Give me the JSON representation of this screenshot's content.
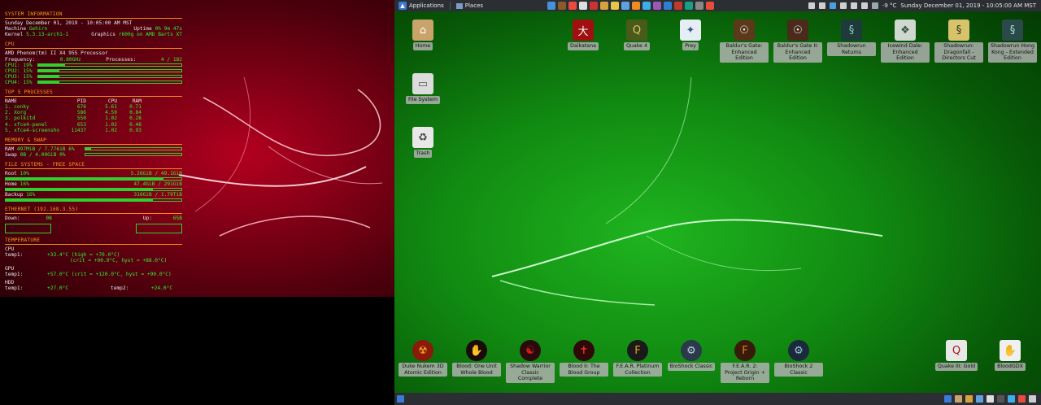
{
  "conky": {
    "system_header": "SYSTEM INFORMATION",
    "date": "Sunday December 01, 2019 - 10:05:00 AM MST",
    "machine_label": "Machine",
    "machine_value": "Gehirn",
    "uptime_label": "Uptime",
    "uptime_value": "0h 9m 47s",
    "kernel_label": "Kernel",
    "kernel_value": "5.3.13-arch1-1",
    "graphics_label": "Graphics",
    "graphics_value": "r600g on AMD Barts XT",
    "cpu_header": "CPU",
    "cpu_model": "AMD Phenom(tm) II X4 955 Processor",
    "frequency_label": "Frequency:",
    "frequency_value": "0.80GHz",
    "processes_label": "Processes:",
    "processes_value": "4 / 182",
    "cpus": [
      {
        "label": "CPU1:",
        "value": "19%",
        "percent": 19
      },
      {
        "label": "CPU2:",
        "value": "15%",
        "percent": 15
      },
      {
        "label": "CPU3:",
        "value": "15%",
        "percent": 15
      },
      {
        "label": "CPU4:",
        "value": "15%",
        "percent": 15
      }
    ],
    "top_header": "TOP 5 PROCESSES",
    "proc_columns": [
      "NAME",
      "PID",
      "CPU",
      "RAM"
    ],
    "processes": [
      {
        "name": "1. conky",
        "pid": "676",
        "cpu": "5.61",
        "ram": "0.71"
      },
      {
        "name": "2. Xorg",
        "pid": "586",
        "cpu": "4.59",
        "ram": "0.84"
      },
      {
        "name": "3. polkitd",
        "pid": "550",
        "cpu": "1.02",
        "ram": "0.28"
      },
      {
        "name": "4. xfce4-panel",
        "pid": "653",
        "cpu": "1.02",
        "ram": "0.48"
      },
      {
        "name": "5. xfce4-screensho",
        "pid": "11437",
        "cpu": "1.02",
        "ram": "0.93"
      }
    ],
    "mem_header": "MEMORY & SWAP",
    "ram_label": "RAM",
    "ram_value": "497MiB / 7.776iB 6%",
    "ram_percent": 6,
    "swap_label": "Swap",
    "swap_value": "0B / 4.00GiB 0%",
    "swap_percent": 0,
    "fs_header": "FILE SYSTEMS - FREE SPACE",
    "root_label": "Root",
    "root_pct": "10%",
    "root_value": "5.26GiB / 49.1GiB",
    "root_percent": 90,
    "home_label": "Home",
    "home_pct": "16%",
    "home_value": "47.4GiB / 291GiB",
    "home_percent": 84,
    "backup_label": "Backup",
    "backup_pct": "16%",
    "backup_value": "316GiB / 1.79TiB",
    "backup_percent": 84,
    "eth_header": "ETHERNET (192.168.3.55)",
    "down_label": "Down:",
    "down_value": "0B",
    "up_label": "Up:",
    "up_value": "65B",
    "temp_header": "TEMPERATURE",
    "cpu_sub": "CPU",
    "cpu_temp_label": "temp1:",
    "cpu_temp_line1": "+33.4°C  (high = +70.0°C)",
    "cpu_temp_line2": "(crit = +90.0°C, hyst = +88.0°C)",
    "gpu_sub": "GPU",
    "gpu_temp_label": "temp1:",
    "gpu_temp_line": "+57.0°C  (crit = +120.0°C, hyst = +90.0°C)",
    "hdd_sub": "HDD",
    "hdd_temp1_label": "temp1:",
    "hdd_temp1_value": "+27.0°C",
    "hdd_temp2_label": "temp2:",
    "hdd_temp2_value": "+24.0°C"
  },
  "top_panel": {
    "applications_label": "Applications",
    "places_label": "Places",
    "weather": "-9 °C",
    "clock": "Sunday December 01, 2019 - 10:05:00 AM MST"
  },
  "desktop": {
    "home": "Home",
    "filesystem": "File System",
    "trash": "Trash",
    "daikatana": "Daikatana",
    "quake4": "Quake 4",
    "prey": "Prey",
    "bg1": "Baldur's Gate: Enhanced Edition",
    "bg2": "Baldur's Gate II: Enhanced Edition",
    "sr_returns": "Shadowrun Returns",
    "icewind": "Icewind Dale: Enhanced Edition",
    "sr_dragonfall": "Shadowrun: Dragonfall - Directors Cut",
    "sr_hongkong": "Shadowrun Hong Kong - Extended Edition",
    "duke": "Duke Nukem 3D Atomic Edition",
    "blood_one": "Blood: One Unit Whole Blood",
    "shadow_warrior": "Shadow Warrior Classic Complete",
    "blood_group": "Blood II: The Blood Group",
    "fear": "F.E.A.R. Platinum Collection",
    "bioshock": "BioShock Classic",
    "fear2": "F.E.A.R. 2: Project Origin + Reborn",
    "bioshock2": "BioShock 2 Classic",
    "quake3": "Quake III: Gold",
    "bloodgdx": "BloodGDX"
  },
  "colors": {
    "conky_header": "#ff9a1a",
    "conky_value": "#33ee33",
    "panel_bg": "#2b2f33",
    "left_wallpaper": "#9a0018",
    "right_wallpaper": "#12a012"
  }
}
